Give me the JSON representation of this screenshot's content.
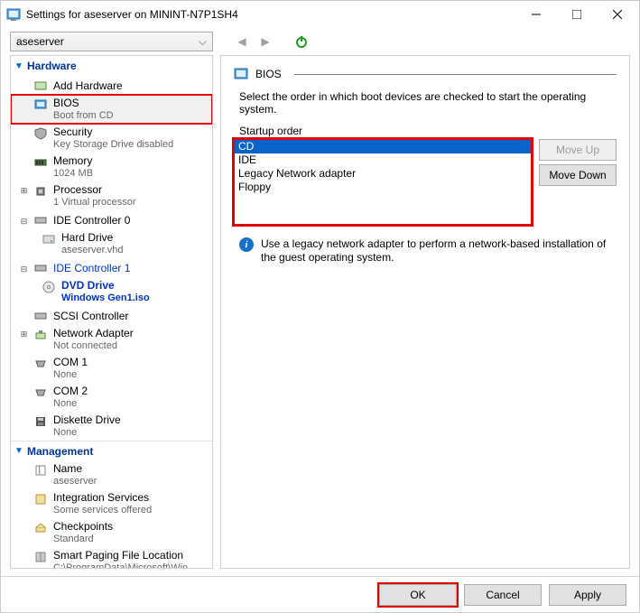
{
  "window": {
    "title": "Settings for aseserver on MININT-N7P1SH4"
  },
  "vm_select": {
    "value": "aseserver"
  },
  "categories": {
    "hardware": "Hardware",
    "management": "Management"
  },
  "tree": {
    "add_hw": "Add Hardware",
    "bios": {
      "name": "BIOS",
      "sub": "Boot from CD"
    },
    "security": {
      "name": "Security",
      "sub": "Key Storage Drive disabled"
    },
    "memory": {
      "name": "Memory",
      "sub": "1024 MB"
    },
    "processor": {
      "name": "Processor",
      "sub": "1 Virtual processor"
    },
    "ide0": {
      "name": "IDE Controller 0"
    },
    "hdd": {
      "name": "Hard Drive",
      "sub": "aseserver.vhd"
    },
    "ide1": {
      "name": "IDE Controller 1"
    },
    "dvd": {
      "name": "DVD Drive",
      "sub": "Windows Gen1.iso"
    },
    "scsi": {
      "name": "SCSI Controller"
    },
    "net": {
      "name": "Network Adapter",
      "sub": "Not connected"
    },
    "com1": {
      "name": "COM 1",
      "sub": "None"
    },
    "com2": {
      "name": "COM 2",
      "sub": "None"
    },
    "diskette": {
      "name": "Diskette Drive",
      "sub": "None"
    },
    "vmname": {
      "name": "Name",
      "sub": "aseserver"
    },
    "integ": {
      "name": "Integration Services",
      "sub": "Some services offered"
    },
    "chk": {
      "name": "Checkpoints",
      "sub": "Standard"
    },
    "paging": {
      "name": "Smart Paging File Location",
      "sub": "C:\\ProgramData\\Microsoft\\Win..."
    }
  },
  "right": {
    "header": "BIOS",
    "description": "Select the order in which boot devices are checked to start the operating system.",
    "startup_label": "Startup order",
    "options": [
      "CD",
      "IDE",
      "Legacy Network adapter",
      "Floppy"
    ],
    "move_up": "Move Up",
    "move_down": "Move Down",
    "info": "Use a legacy network adapter to perform a network-based installation of the guest operating system."
  },
  "footer": {
    "ok": "OK",
    "cancel": "Cancel",
    "apply": "Apply"
  }
}
